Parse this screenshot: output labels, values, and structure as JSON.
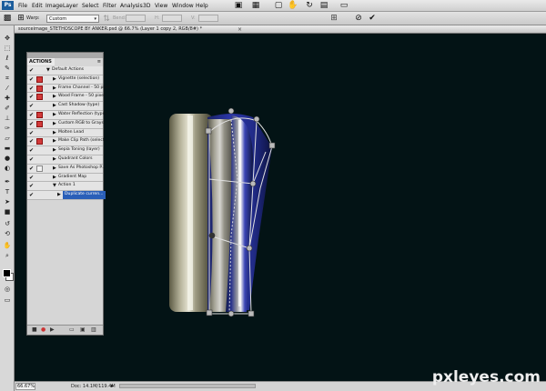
{
  "app": {
    "logo": "Ps"
  },
  "menu": [
    "File",
    "Edit",
    "Image",
    "Layer",
    "Select",
    "Filter",
    "Analysis",
    "3D",
    "View",
    "Window",
    "Help"
  ],
  "options_bar": {
    "warp_label": "Warp:",
    "warp_value": "Custom",
    "bend_label": "Bend:",
    "h_label": "H:",
    "v_label": "V:"
  },
  "document": {
    "tab_title": "sourceimage_STETHOSCOPE BY ANKER.psd @ 66.7% (Layer 1 copy 2, RGB/8#) *",
    "close": "×"
  },
  "status": {
    "zoom": "66.67%",
    "doc_size": "Doc: 14.1M/119.4M"
  },
  "actions_panel": {
    "tab": "ACTIONS",
    "rows": [
      {
        "label": "Default Actions",
        "check": "✔",
        "dialog": "none",
        "indent": 0,
        "toggle": "▼",
        "selected": false
      },
      {
        "label": "Vignette (selection)",
        "check": "✔",
        "dialog": "red",
        "indent": 1,
        "toggle": "▶",
        "selected": false
      },
      {
        "label": "Frame Channel - 50 pixel",
        "check": "✔",
        "dialog": "red",
        "indent": 1,
        "toggle": "▶",
        "selected": false
      },
      {
        "label": "Wood Frame - 50 pixel",
        "check": "✔",
        "dialog": "red",
        "indent": 1,
        "toggle": "▶",
        "selected": false
      },
      {
        "label": "Cast Shadow (type)",
        "check": "✔",
        "dialog": "none",
        "indent": 1,
        "toggle": "▶",
        "selected": false
      },
      {
        "label": "Water Reflection (type)",
        "check": "✔",
        "dialog": "red",
        "indent": 1,
        "toggle": "▶",
        "selected": false
      },
      {
        "label": "Custom RGB to Grays...",
        "check": "✔",
        "dialog": "red",
        "indent": 1,
        "toggle": "▶",
        "selected": false
      },
      {
        "label": "Molten Lead",
        "check": "✔",
        "dialog": "none",
        "indent": 1,
        "toggle": "▶",
        "selected": false
      },
      {
        "label": "Make Clip Path (select...",
        "check": "✔",
        "dialog": "red",
        "indent": 1,
        "toggle": "▶",
        "selected": false
      },
      {
        "label": "Sepia Toning (layer)",
        "check": "✔",
        "dialog": "none",
        "indent": 1,
        "toggle": "▶",
        "selected": false
      },
      {
        "label": "Quadrant Colors",
        "check": "✔",
        "dialog": "none",
        "indent": 1,
        "toggle": "▶",
        "selected": false
      },
      {
        "label": "Save As Photoshop P...",
        "check": "✔",
        "dialog": "plain",
        "indent": 1,
        "toggle": "▶",
        "selected": false
      },
      {
        "label": "Gradient Map",
        "check": "✔",
        "dialog": "none",
        "indent": 1,
        "toggle": "▶",
        "selected": false
      },
      {
        "label": "Action 1",
        "check": "✔",
        "dialog": "none",
        "indent": 1,
        "toggle": "▼",
        "selected": false
      },
      {
        "label": "Duplicate curren...",
        "check": "✔",
        "dialog": "none",
        "indent": 2,
        "toggle": "▶",
        "selected": true
      }
    ]
  },
  "watermark": "pxleyes.com",
  "colors": {
    "canvas": "#031315",
    "selection": "#2a5fb8",
    "red_dialog": "#d23a3a"
  },
  "icons": {
    "toolbox": [
      "move-tool-icon",
      "marquee-tool-icon",
      "lasso-tool-icon",
      "quick-select-tool-icon",
      "crop-tool-icon",
      "eyedropper-tool-icon",
      "healing-brush-icon",
      "brush-tool-icon",
      "clone-stamp-icon",
      "history-brush-icon",
      "eraser-tool-icon",
      "gradient-tool-icon",
      "blur-tool-icon",
      "dodge-tool-icon",
      "pen-tool-icon",
      "type-tool-icon",
      "path-select-icon",
      "shape-tool-icon",
      "3d-rotate-icon",
      "3d-orbit-icon",
      "hand-tool-icon",
      "zoom-tool-icon"
    ]
  }
}
